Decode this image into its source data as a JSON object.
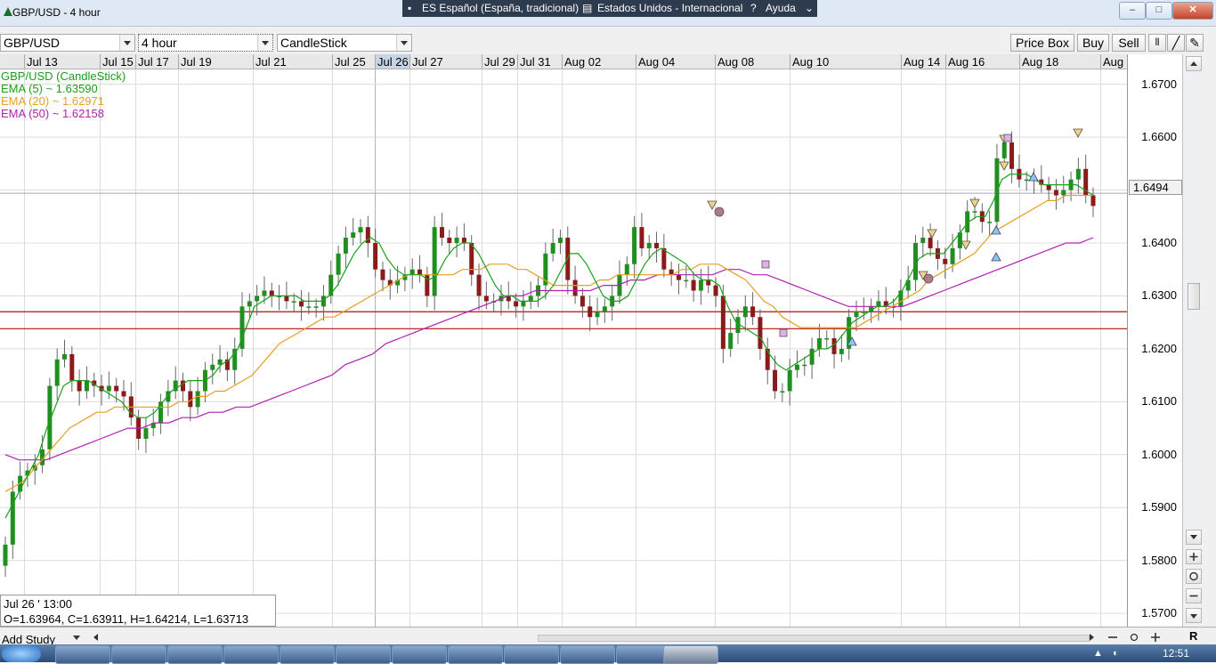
{
  "window": {
    "title": "GBP/USD - 4 hour",
    "language_bar": {
      "language": "ES Español (España, tradicional)",
      "layout": "Estados Unidos - Internacional",
      "help": "Ayuda"
    }
  },
  "toolbar": {
    "symbol": "GBP/USD",
    "interval": "4 hour",
    "chart_type": "CandleStick",
    "price_box_label": "Price Box",
    "buy_label": "Buy",
    "sell_label": "Sell"
  },
  "legend": {
    "series": "GBP/USD (CandleStick)",
    "ema5": "EMA (5) ~ 1.63590",
    "ema20": "EMA (20) ~ 1.62971",
    "ema50": "EMA (50) ~ 1.62158"
  },
  "current_price": "1.6494",
  "current_price_value": 1.6494,
  "info": {
    "date": "Jul 26 ' 13:00",
    "ohlc": "O=1.63964, C=1.63911, H=1.64214, L=1.63713"
  },
  "bottom": {
    "add_study": "Add Study"
  },
  "clock": "12:51",
  "colors": {
    "up": "#1f8f1f",
    "down": "#8b1a1a",
    "ema5": "#1aa01a",
    "ema20": "#e6a020",
    "ema50": "#b020b0",
    "support": "#b01010"
  },
  "chart_data": {
    "type": "candlestick",
    "date_labels": [
      "Jul 13",
      "Jul 15",
      "Jul 17",
      "Jul 19",
      "Jul 21",
      "Jul 25",
      "Jul 26",
      "Jul 27",
      "Jul 29",
      "Jul 31",
      "Aug 02",
      "Aug 04",
      "Aug 08",
      "Aug 10",
      "Aug 14",
      "Aug 16",
      "Aug 18",
      "Aug"
    ],
    "highlighted_date": "Jul 26",
    "y_tick_labels": [
      "1.6700",
      "1.6600",
      "1.6500",
      "1.6400",
      "1.6300",
      "1.6200",
      "1.6100",
      "1.6000",
      "1.5900",
      "1.5800",
      "1.5700"
    ],
    "ylim": [
      1.5675,
      1.6728
    ],
    "horizontal_levels": [
      1.627,
      1.6238
    ],
    "close_series": [
      1.583,
      1.593,
      1.596,
      1.597,
      1.598,
      1.601,
      1.613,
      1.618,
      1.619,
      1.614,
      1.612,
      1.614,
      1.613,
      1.612,
      1.613,
      1.612,
      1.611,
      1.607,
      1.603,
      1.605,
      1.606,
      1.61,
      1.612,
      1.614,
      1.612,
      1.609,
      1.612,
      1.616,
      1.617,
      1.618,
      1.616,
      1.62,
      1.628,
      1.629,
      1.63,
      1.631,
      1.63,
      1.63,
      1.629,
      1.629,
      1.628,
      1.628,
      1.628,
      1.63,
      1.634,
      1.638,
      1.641,
      1.642,
      1.643,
      1.64,
      1.635,
      1.633,
      1.632,
      1.633,
      1.634,
      1.635,
      1.634,
      1.63,
      1.643,
      1.641,
      1.64,
      1.641,
      1.64,
      1.634,
      1.63,
      1.629,
      1.629,
      1.63,
      1.629,
      1.628,
      1.629,
      1.63,
      1.632,
      1.638,
      1.64,
      1.641,
      1.633,
      1.63,
      1.628,
      1.626,
      1.627,
      1.628,
      1.63,
      1.634,
      1.636,
      1.643,
      1.639,
      1.64,
      1.639,
      1.635,
      1.634,
      1.633,
      1.633,
      1.631,
      1.633,
      1.632,
      1.63,
      1.62,
      1.623,
      1.626,
      1.628,
      1.626,
      1.62,
      1.616,
      1.612,
      1.612,
      1.616,
      1.617,
      1.617,
      1.62,
      1.622,
      1.622,
      1.619,
      1.62,
      1.626,
      1.627,
      1.627,
      1.628,
      1.629,
      1.628,
      1.628,
      1.631,
      1.633,
      1.64,
      1.641,
      1.639,
      1.637,
      1.636,
      1.639,
      1.642,
      1.646,
      1.646,
      1.644,
      1.644,
      1.656,
      1.659,
      1.654,
      1.652,
      1.652,
      1.652,
      1.651,
      1.65,
      1.649,
      1.65,
      1.652,
      1.654,
      1.649,
      1.647
    ],
    "ema5": [
      1.588,
      1.591,
      1.594,
      1.597,
      1.6,
      1.605,
      1.609,
      1.613,
      1.614,
      1.614,
      1.614,
      1.613,
      1.612,
      1.611,
      1.61,
      1.608,
      1.607,
      1.607,
      1.608,
      1.61,
      1.612,
      1.613,
      1.614,
      1.614,
      1.614,
      1.615,
      1.617,
      1.618,
      1.62,
      1.624,
      1.628,
      1.629,
      1.63,
      1.63,
      1.63,
      1.63,
      1.629,
      1.629,
      1.629,
      1.63,
      1.632,
      1.635,
      1.638,
      1.64,
      1.641,
      1.64,
      1.637,
      1.635,
      1.634,
      1.634,
      1.634,
      1.633,
      1.634,
      1.637,
      1.639,
      1.64,
      1.64,
      1.638,
      1.635,
      1.632,
      1.63,
      1.63,
      1.629,
      1.629,
      1.629,
      1.63,
      1.632,
      1.635,
      1.638,
      1.638,
      1.636,
      1.633,
      1.63,
      1.629,
      1.629,
      1.63,
      1.633,
      1.636,
      1.638,
      1.639,
      1.638,
      1.637,
      1.636,
      1.634,
      1.633,
      1.633,
      1.632,
      1.628,
      1.625,
      1.624,
      1.623,
      1.622,
      1.619,
      1.617,
      1.616,
      1.617,
      1.618,
      1.619,
      1.62,
      1.62,
      1.621,
      1.623,
      1.625,
      1.626,
      1.627,
      1.628,
      1.628,
      1.629,
      1.631,
      1.634,
      1.637,
      1.638,
      1.638,
      1.638,
      1.64,
      1.642,
      1.644,
      1.645,
      1.645,
      1.648,
      1.652,
      1.653,
      1.653,
      1.653,
      1.652,
      1.651,
      1.651,
      1.651,
      1.651,
      1.651,
      1.65,
      1.649
    ],
    "ema20": [
      1.593,
      1.594,
      1.595,
      1.597,
      1.599,
      1.601,
      1.603,
      1.605,
      1.606,
      1.607,
      1.608,
      1.608,
      1.609,
      1.609,
      1.609,
      1.609,
      1.609,
      1.609,
      1.609,
      1.61,
      1.61,
      1.611,
      1.611,
      1.612,
      1.612,
      1.613,
      1.614,
      1.615,
      1.617,
      1.619,
      1.621,
      1.622,
      1.623,
      1.624,
      1.625,
      1.626,
      1.626,
      1.627,
      1.628,
      1.629,
      1.63,
      1.631,
      1.632,
      1.633,
      1.634,
      1.634,
      1.634,
      1.634,
      1.634,
      1.634,
      1.635,
      1.635,
      1.635,
      1.636,
      1.636,
      1.636,
      1.635,
      1.635,
      1.634,
      1.633,
      1.632,
      1.632,
      1.632,
      1.632,
      1.632,
      1.633,
      1.633,
      1.634,
      1.634,
      1.634,
      1.634,
      1.634,
      1.634,
      1.634,
      1.635,
      1.635,
      1.636,
      1.636,
      1.636,
      1.635,
      1.634,
      1.633,
      1.631,
      1.629,
      1.628,
      1.626,
      1.625,
      1.624,
      1.624,
      1.624,
      1.624,
      1.624,
      1.624,
      1.624,
      1.625,
      1.626,
      1.627,
      1.628,
      1.629,
      1.63,
      1.631,
      1.633,
      1.634,
      1.635,
      1.636,
      1.637,
      1.638,
      1.64,
      1.642,
      1.643,
      1.644,
      1.645,
      1.646,
      1.647,
      1.648,
      1.648,
      1.649,
      1.649,
      1.649,
      1.649
    ],
    "ema50": [
      1.6,
      1.599,
      1.599,
      1.599,
      1.6,
      1.601,
      1.602,
      1.603,
      1.604,
      1.605,
      1.605,
      1.606,
      1.606,
      1.607,
      1.607,
      1.608,
      1.608,
      1.609,
      1.609,
      1.61,
      1.611,
      1.612,
      1.613,
      1.614,
      1.615,
      1.617,
      1.618,
      1.619,
      1.621,
      1.622,
      1.623,
      1.624,
      1.625,
      1.626,
      1.627,
      1.628,
      1.629,
      1.63,
      1.63,
      1.631,
      1.631,
      1.631,
      1.631,
      1.631,
      1.632,
      1.632,
      1.633,
      1.633,
      1.634,
      1.634,
      1.634,
      1.634,
      1.634,
      1.635,
      1.635,
      1.634,
      1.634,
      1.633,
      1.632,
      1.631,
      1.63,
      1.629,
      1.628,
      1.628,
      1.628,
      1.628,
      1.628,
      1.629,
      1.63,
      1.631,
      1.632,
      1.633,
      1.634,
      1.635,
      1.636,
      1.637,
      1.638,
      1.639,
      1.64,
      1.64,
      1.641
    ]
  }
}
